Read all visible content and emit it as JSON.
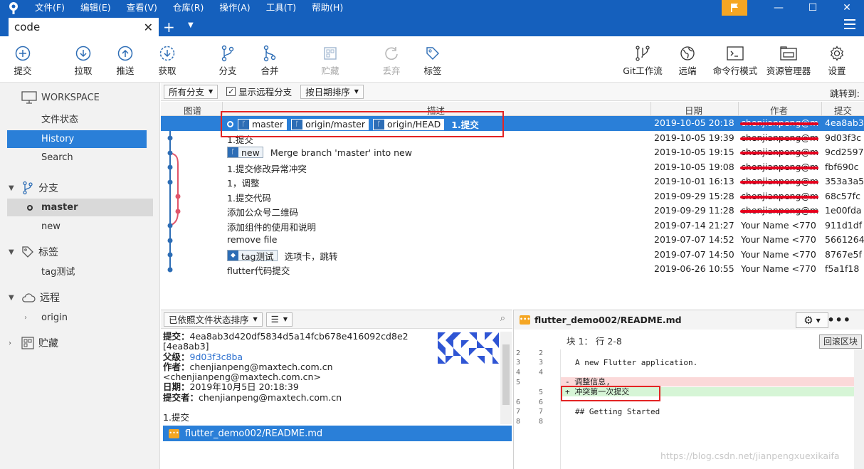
{
  "menu": [
    "文件(F)",
    "编辑(E)",
    "查看(V)",
    "仓库(R)",
    "操作(A)",
    "工具(T)",
    "帮助(H)"
  ],
  "tab": {
    "title": "code"
  },
  "toolbar": {
    "commit": "提交",
    "pull": "拉取",
    "push": "推送",
    "fetch": "获取",
    "branch": "分支",
    "merge": "合并",
    "stash": "贮藏",
    "discard": "丢弃",
    "tag": "标签",
    "gitflow": "Git工作流",
    "remote": "远端",
    "terminal": "命令行模式",
    "explorer": "资源管理器",
    "settings": "设置"
  },
  "sidebar": {
    "workspace": "WORKSPACE",
    "file_status": "文件状态",
    "history": "History",
    "search": "Search",
    "branches_title": "分支",
    "branches": [
      "master",
      "new"
    ],
    "tags_title": "标签",
    "tags": [
      "tag测试"
    ],
    "remotes_title": "远程",
    "remotes": [
      "origin"
    ],
    "stash_title": "贮藏"
  },
  "filter": {
    "all_branches": "所有分支",
    "show_remote": "显示远程分支",
    "sort_date": "按日期排序",
    "jump_to": "跳转到:"
  },
  "columns": {
    "graph": "图谱",
    "desc": "描述",
    "date": "日期",
    "author": "作者",
    "commit": "提交"
  },
  "commits": [
    {
      "tags": [
        "master",
        "origin/master",
        "origin/HEAD"
      ],
      "message": "1.提交",
      "date": "2019-10-05 20:18",
      "author": "chenjianpeng@m",
      "hash": "4ea8ab3"
    },
    {
      "tags": [],
      "message": "1.提交",
      "date": "2019-10-05 19:39",
      "author": "chenjianpeng@m",
      "hash": "9d03f3c"
    },
    {
      "tags": [
        "new"
      ],
      "message": "Merge branch 'master' into new",
      "date": "2019-10-05 19:15",
      "author": "chenjianpeng@m",
      "hash": "9cd2597"
    },
    {
      "tags": [],
      "message": "1.提交修改异常冲突",
      "date": "2019-10-05 19:08",
      "author": "chenjianpeng@m",
      "hash": "fbf690c"
    },
    {
      "tags": [],
      "message": "1，调整",
      "date": "2019-10-01 16:13",
      "author": "chenjianpeng@m",
      "hash": "353a3a5"
    },
    {
      "tags": [],
      "message": "1.提交代码",
      "date": "2019-09-29 15:28",
      "author": "chenjianpeng@m",
      "hash": "68c57fc"
    },
    {
      "tags": [],
      "message": "添加公众号二维码",
      "date": "2019-09-29 11:28",
      "author": "chenjianpeng@m",
      "hash": "1e00fda"
    },
    {
      "tags": [],
      "message": "添加组件的使用和说明",
      "date": "2019-07-14 21:27",
      "author": "Your Name <770",
      "hash": "911d1df"
    },
    {
      "tags": [],
      "message": "remove file",
      "date": "2019-07-07 14:52",
      "author": "Your Name <770",
      "hash": "5661264"
    },
    {
      "tags": [
        "tag测试"
      ],
      "message": "选项卡，跳转",
      "date": "2019-07-07 14:50",
      "author": "Your Name <770",
      "hash": "8767e5f"
    },
    {
      "tags": [],
      "message": "flutter代码提交",
      "date": "2019-06-26 10:55",
      "author": "Your Name <770",
      "hash": "f5a1f18"
    }
  ],
  "bottom_left": {
    "sort_mode": "已依照文件状态排序",
    "commit_label": "提交：",
    "commit_full": "4ea8ab3d420df5834d5a14fcb678e416092cd8e2",
    "commit_short": "[4ea8ab3]",
    "parent_label": "父级：",
    "parent": "9d03f3c8ba",
    "author_label": "作者：",
    "author_1": "chenjianpeng@maxtech.com.cn",
    "author_2": "<chenjianpeng@maxtech.com.cn>",
    "date_label": "日期：",
    "date": "2019年10月5日 20:18:39",
    "committer_label": "提交者：",
    "committer": "chenjianpeng@maxtech.com.cn",
    "message": "1.提交",
    "file": "flutter_demo002/README.md"
  },
  "diff": {
    "file": "flutter_demo002/README.md",
    "hunk": "块 1： 行 2-8",
    "revert": "回滚区块",
    "lines": [
      {
        "old": "2",
        "new": "2",
        "type": "ctx",
        "text": ""
      },
      {
        "old": "3",
        "new": "3",
        "type": "ctx",
        "text": "A new Flutter application."
      },
      {
        "old": "4",
        "new": "4",
        "type": "ctx",
        "text": ""
      },
      {
        "old": "5",
        "new": "",
        "type": "del",
        "text": "- 调整信息,"
      },
      {
        "old": "",
        "new": "5",
        "type": "add",
        "text": "+ 冲突第一次提交"
      },
      {
        "old": "6",
        "new": "6",
        "type": "ctx",
        "text": ""
      },
      {
        "old": "7",
        "new": "7",
        "type": "ctx",
        "text": "## Getting Started"
      },
      {
        "old": "8",
        "new": "8",
        "type": "ctx",
        "text": ""
      }
    ]
  },
  "watermark": "https://blog.csdn.net/jianpengxuexikaifa",
  "colors": {
    "accent": "#1560bd",
    "selection": "#2a7fd8",
    "highlight_box": "#e32424"
  }
}
